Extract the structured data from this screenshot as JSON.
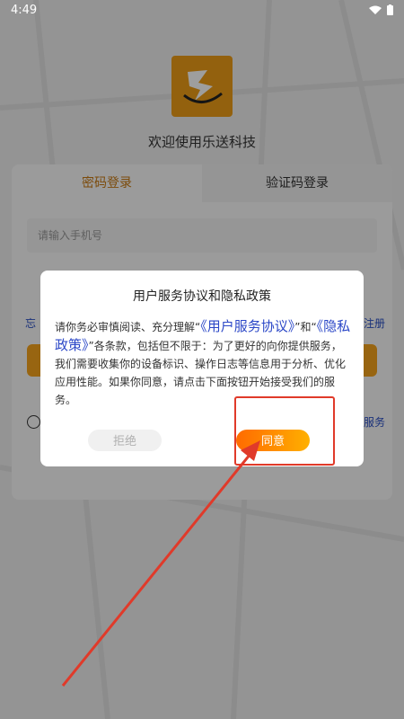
{
  "status_bar": {
    "time": "4:49"
  },
  "app": {
    "welcome": "欢迎使用乐送科技",
    "tabs": [
      {
        "label": "密码登录",
        "active": true
      },
      {
        "label": "验证码登录",
        "active": false
      }
    ],
    "phone_placeholder": "请输入手机号",
    "partial_left": "忘",
    "partial_right_1": "注册",
    "partial_right_2": "服务"
  },
  "dialog": {
    "title": "用户服务协议和隐私政策",
    "body_pre": "请你务必审慎阅读、充分理解“",
    "link_service": "《用户服务协议》",
    "body_and": "”和“",
    "link_privacy": "《隐私政策》",
    "body_post": "”各条款，包括但不限于：为了更好的向你提供服务，我们需要收集你的设备标识、操作日志等信息用于分析、优化应用性能。如果你同意，请点击下面按钮开始接受我们的服务。",
    "reject_label": "拒绝",
    "agree_label": "同意"
  },
  "colors": {
    "accent_orange": "#ff8a00",
    "link_blue": "#2b47c7",
    "annotation_red": "#e03a2a"
  }
}
